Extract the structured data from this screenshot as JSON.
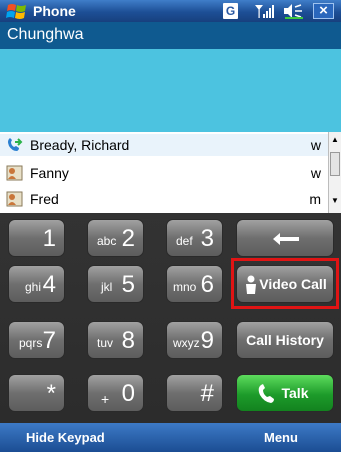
{
  "titlebar": {
    "app_title": "Phone",
    "g_icon_label": "G"
  },
  "carrier": {
    "name": "Chunghwa"
  },
  "contacts": [
    {
      "name": "Bready, Richard",
      "tag": "w",
      "icon": "outgoing-call-icon"
    },
    {
      "name": "Fanny",
      "tag": "w",
      "icon": "contact-card-icon"
    },
    {
      "name": "Fred",
      "tag": "m",
      "icon": "contact-card-icon"
    }
  ],
  "keypad": {
    "k1": {
      "digit": "1",
      "letters": ""
    },
    "k2": {
      "digit": "2",
      "letters": "abc"
    },
    "k3": {
      "digit": "3",
      "letters": "def"
    },
    "k4": {
      "digit": "4",
      "letters": "ghi"
    },
    "k5": {
      "digit": "5",
      "letters": "jkl"
    },
    "k6": {
      "digit": "6",
      "letters": "mno"
    },
    "k7": {
      "digit": "7",
      "letters": "pqrs"
    },
    "k8": {
      "digit": "8",
      "letters": "tuv"
    },
    "k9": {
      "digit": "9",
      "letters": "wxyz"
    },
    "kstar": {
      "digit": "*",
      "letters": ""
    },
    "k0": {
      "digit": "0",
      "letters": "+"
    },
    "khash": {
      "digit": "#",
      "letters": ""
    },
    "video_call": "Video Call",
    "call_history": "Call History",
    "talk": "Talk"
  },
  "softkeys": {
    "left": "Hide Keypad",
    "right": "Menu"
  },
  "colors": {
    "title_blue": "#1d4f96",
    "carrier_bar": "#0f5a90",
    "dial_area": "#4cc3e0",
    "talk_green": "#1d9b2a",
    "highlight_red": "#e01414"
  }
}
